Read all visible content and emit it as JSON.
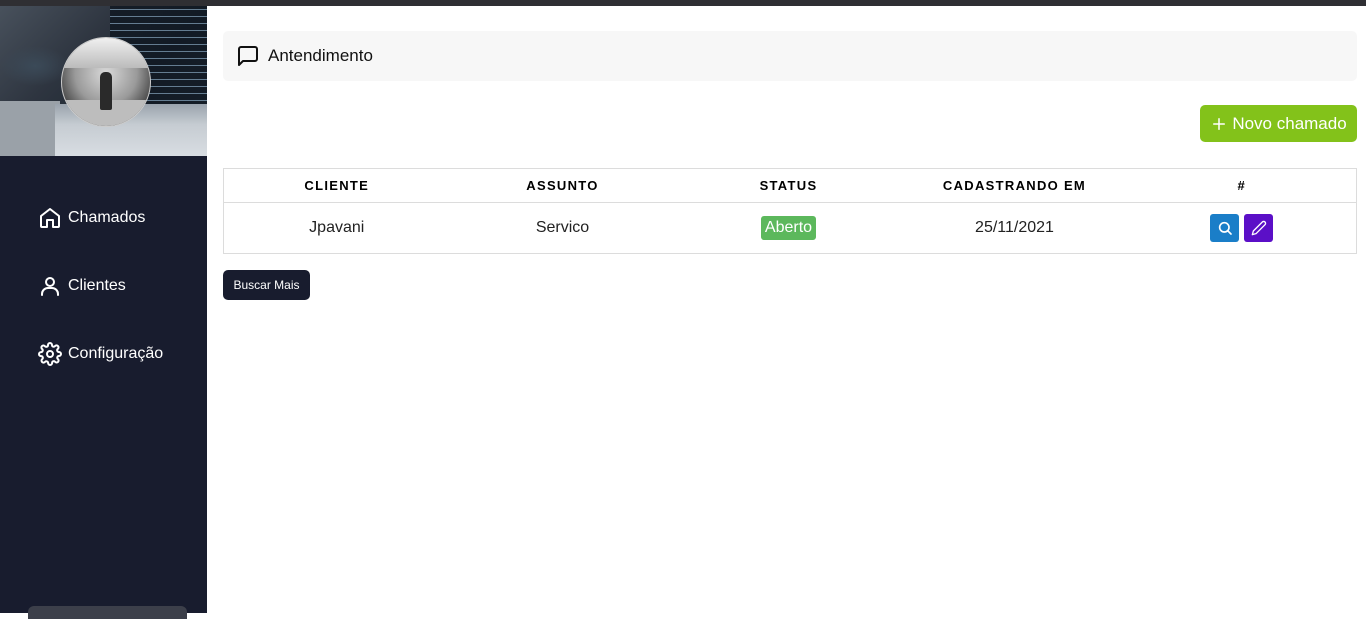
{
  "sidebar": {
    "items": [
      {
        "label": "Chamados",
        "icon": "home-icon"
      },
      {
        "label": "Clientes",
        "icon": "user-icon"
      },
      {
        "label": "Configuração",
        "icon": "gear-icon"
      }
    ]
  },
  "header": {
    "title": "Antendimento",
    "icon": "message-square-icon"
  },
  "new_button": {
    "label": "Novo chamado",
    "icon": "plus-icon",
    "color": "#83c21a"
  },
  "table": {
    "columns": [
      "CLIENTE",
      "ASSUNTO",
      "STATUS",
      "CADASTRANDO EM",
      "#"
    ],
    "rows": [
      {
        "cliente": "Jpavani",
        "assunto": "Servico",
        "status": "Aberto",
        "cadastrado": "25/11/2021"
      }
    ]
  },
  "more_button": {
    "label": "Buscar Mais"
  },
  "colors": {
    "sidebar": "#181c2e",
    "status_open": "#5cb85c",
    "view_btn": "#1a7ec8",
    "edit_btn": "#5b0fc7"
  }
}
